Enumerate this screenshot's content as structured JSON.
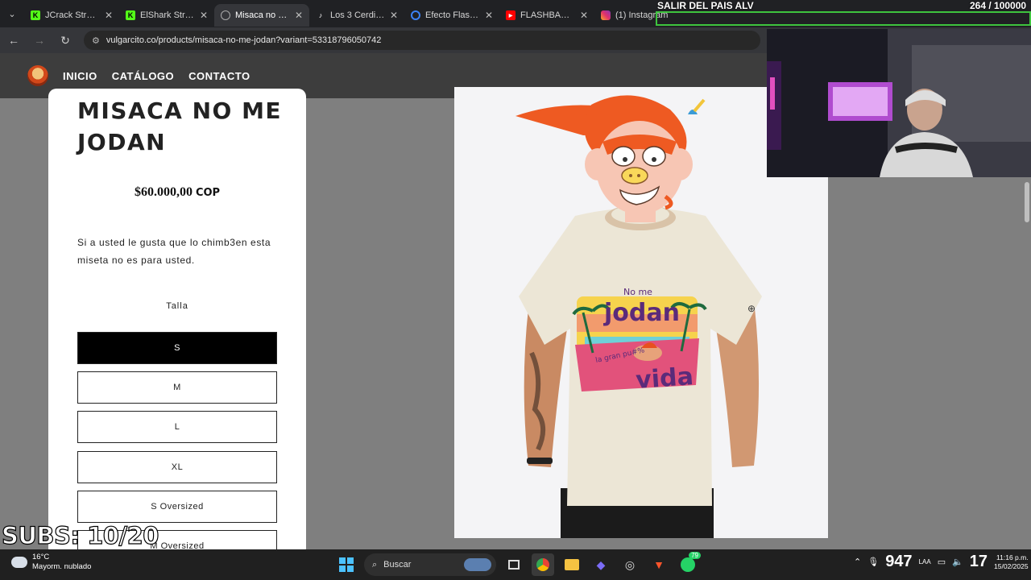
{
  "browser": {
    "tabs": [
      {
        "title": "JCrack Stream",
        "icon": "kick-icon",
        "color": "#53fc18"
      },
      {
        "title": "ElShark Stream",
        "icon": "kick-icon",
        "color": "#53fc18"
      },
      {
        "title": "Misaca no me",
        "icon": "globe-icon",
        "color": "#aaaaaa",
        "active": true
      },
      {
        "title": "Los 3 Cerditos",
        "icon": "tiktok-icon",
        "color": "#ffffff"
      },
      {
        "title": "Efecto Flashba",
        "icon": "edge-icon",
        "color": "#3b82f6"
      },
      {
        "title": "FLASHBACK |",
        "icon": "youtube-icon",
        "color": "#ff0000"
      },
      {
        "title": "(1) Instagram",
        "icon": "instagram-icon",
        "color": "#e1306c"
      }
    ],
    "url": "vulgarcito.co/products/misaca-no-me-jodan?variant=53318796050742"
  },
  "site": {
    "nav": [
      "INICIO",
      "CATÁLOGO",
      "CONTACTO"
    ]
  },
  "product": {
    "title": "MISACA NO ME JODAN",
    "price": "$60.000,00",
    "currency": "COP",
    "description": "Si a usted le gusta que lo chimb3en esta miseta no es para usted.",
    "size_label": "Talla",
    "sizes": [
      "S",
      "M",
      "L",
      "XL",
      "S Oversized",
      "M Oversized"
    ],
    "selected_size": "S",
    "shirt_text": [
      "No me",
      "jodan",
      "la gran pu#%",
      "vida"
    ]
  },
  "stream_overlay": {
    "title": "SALIR DEL PAIS ALV",
    "counter": "264 / 100000",
    "subs": "SUBS: 10/20",
    "goal_bar_color": "#3ec43e"
  },
  "taskbar": {
    "weather_temp": "16°C",
    "weather_desc": "Mayorm. nublado",
    "search_placeholder": "Buscar",
    "badge_count": "79",
    "overlay_number_1": "947",
    "overlay_number_2": "17",
    "overlay_number_3": "10",
    "time": "11:16 p.m.",
    "date": "15/02/2025",
    "lang": "LAA"
  }
}
